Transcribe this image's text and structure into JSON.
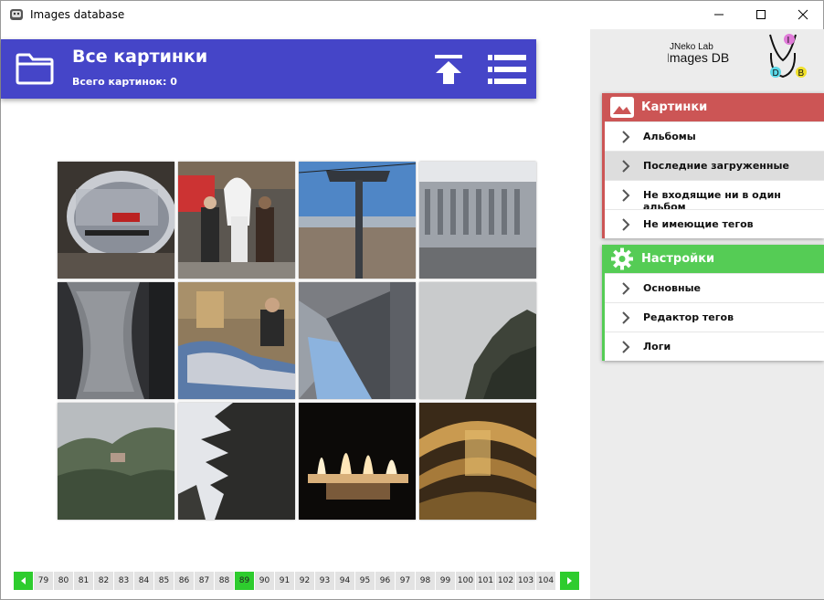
{
  "window": {
    "title": "Images database",
    "controls": [
      "minimize",
      "maximize",
      "close"
    ]
  },
  "header": {
    "title": "Все картинки",
    "subtitle": "Всего картинок: 0",
    "color": "#4545c8"
  },
  "logo": {
    "line1": "JNeko Lab",
    "line2": "Images DB",
    "letters": [
      "I",
      "D",
      "B"
    ]
  },
  "menus": {
    "pictures": {
      "title": "Картинки",
      "color": "#cc5555",
      "items": [
        {
          "label": "Альбомы"
        },
        {
          "label": "Последние загруженные",
          "highlighted": true
        },
        {
          "label": "Не входящие ни в один альбом"
        },
        {
          "label": "Не имеющие тегов"
        }
      ]
    },
    "settings": {
      "title": "Настройки",
      "color": "#55cc55",
      "items": [
        {
          "label": "Основные"
        },
        {
          "label": "Редактор тегов"
        },
        {
          "label": "Логи"
        }
      ]
    }
  },
  "thumbnails": [
    {
      "subject": "tunnel-reflection"
    },
    {
      "subject": "street-angel-performer"
    },
    {
      "subject": "cable-car-tower"
    },
    {
      "subject": "building-facade"
    },
    {
      "subject": "window-rain"
    },
    {
      "subject": "mosaic-bench"
    },
    {
      "subject": "street-sky"
    },
    {
      "subject": "misty-cliff"
    },
    {
      "subject": "foggy-forest"
    },
    {
      "subject": "cathedral-spires"
    },
    {
      "subject": "night-fountain"
    },
    {
      "subject": "golden-ceiling"
    }
  ],
  "pager": {
    "pages": [
      "79",
      "80",
      "81",
      "82",
      "83",
      "84",
      "85",
      "86",
      "87",
      "88",
      "89",
      "90",
      "91",
      "92",
      "93",
      "94",
      "95",
      "96",
      "97",
      "98",
      "99",
      "100",
      "101",
      "102",
      "103",
      "104"
    ],
    "current": "89",
    "accent": "#2ecc2e"
  }
}
